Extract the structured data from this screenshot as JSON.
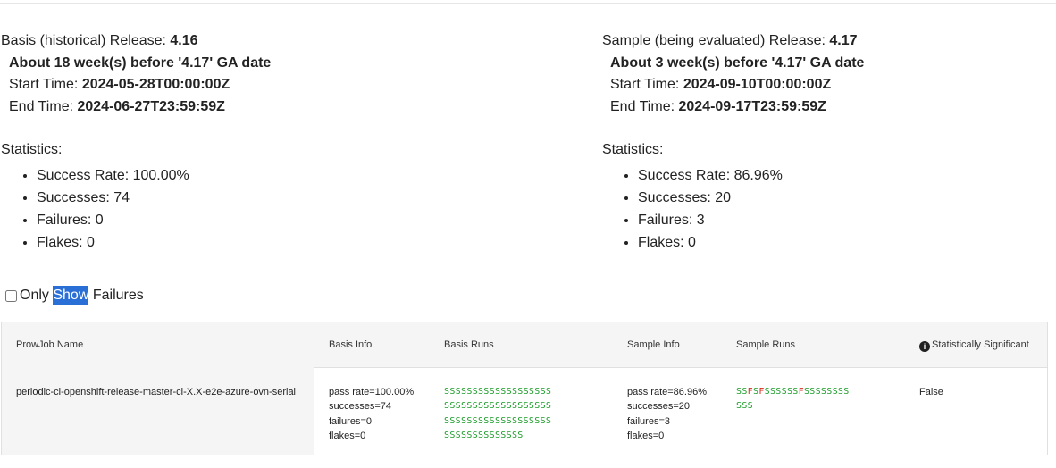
{
  "basis": {
    "release_label": "Basis (historical) Release:",
    "release": "4.16",
    "about": "About 18 week(s) before '4.17' GA date",
    "start_label": "Start Time:",
    "start": "2024-05-28T00:00:00Z",
    "end_label": "End Time:",
    "end": "2024-06-27T23:59:59Z",
    "stats_label": "Statistics:",
    "stats": [
      "Success Rate: 100.00%",
      "Successes: 74",
      "Failures: 0",
      "Flakes: 0"
    ]
  },
  "sample": {
    "release_label": "Sample (being evaluated) Release:",
    "release": "4.17",
    "about": "About 3 week(s) before '4.17' GA date",
    "start_label": "Start Time:",
    "start": "2024-09-10T00:00:00Z",
    "end_label": "End Time:",
    "end": "2024-09-17T23:59:59Z",
    "stats_label": "Statistics:",
    "stats": [
      "Success Rate: 86.96%",
      "Successes: 20",
      "Failures: 3",
      "Flakes: 0"
    ]
  },
  "filter": {
    "label_before": "Only",
    "label_highlight": "Show",
    "label_after": "Failures",
    "checked": false
  },
  "table": {
    "headers": {
      "prowjob": "ProwJob Name",
      "basis_info": "Basis Info",
      "basis_runs": "Basis Runs",
      "sample_info": "Sample Info",
      "sample_runs": "Sample Runs",
      "significant": "Statistically Significant"
    },
    "row": {
      "prowjob": "periodic-ci-openshift-release-master-ci-X.X-e2e-azure-ovn-serial",
      "basis_info": [
        "pass rate=100.00%",
        "successes=74",
        "failures=0",
        "flakes=0"
      ],
      "basis_runs": [
        "SSSSSSSSSSSSSSSSSSS",
        "SSSSSSSSSSSSSSSSSSS",
        "SSSSSSSSSSSSSSSSSSS",
        "SSSSSSSSSSSSSS"
      ],
      "sample_info": [
        "pass rate=86.96%",
        "successes=20",
        "failures=3",
        "flakes=0"
      ],
      "sample_runs": [
        "SSFSFSSSSSSFSSSSSSSS",
        "SSS"
      ],
      "significant": "False"
    }
  },
  "colors": {
    "success": "#1e9e2b",
    "failure": "#d62d20",
    "highlight": "#2a6fd6"
  }
}
